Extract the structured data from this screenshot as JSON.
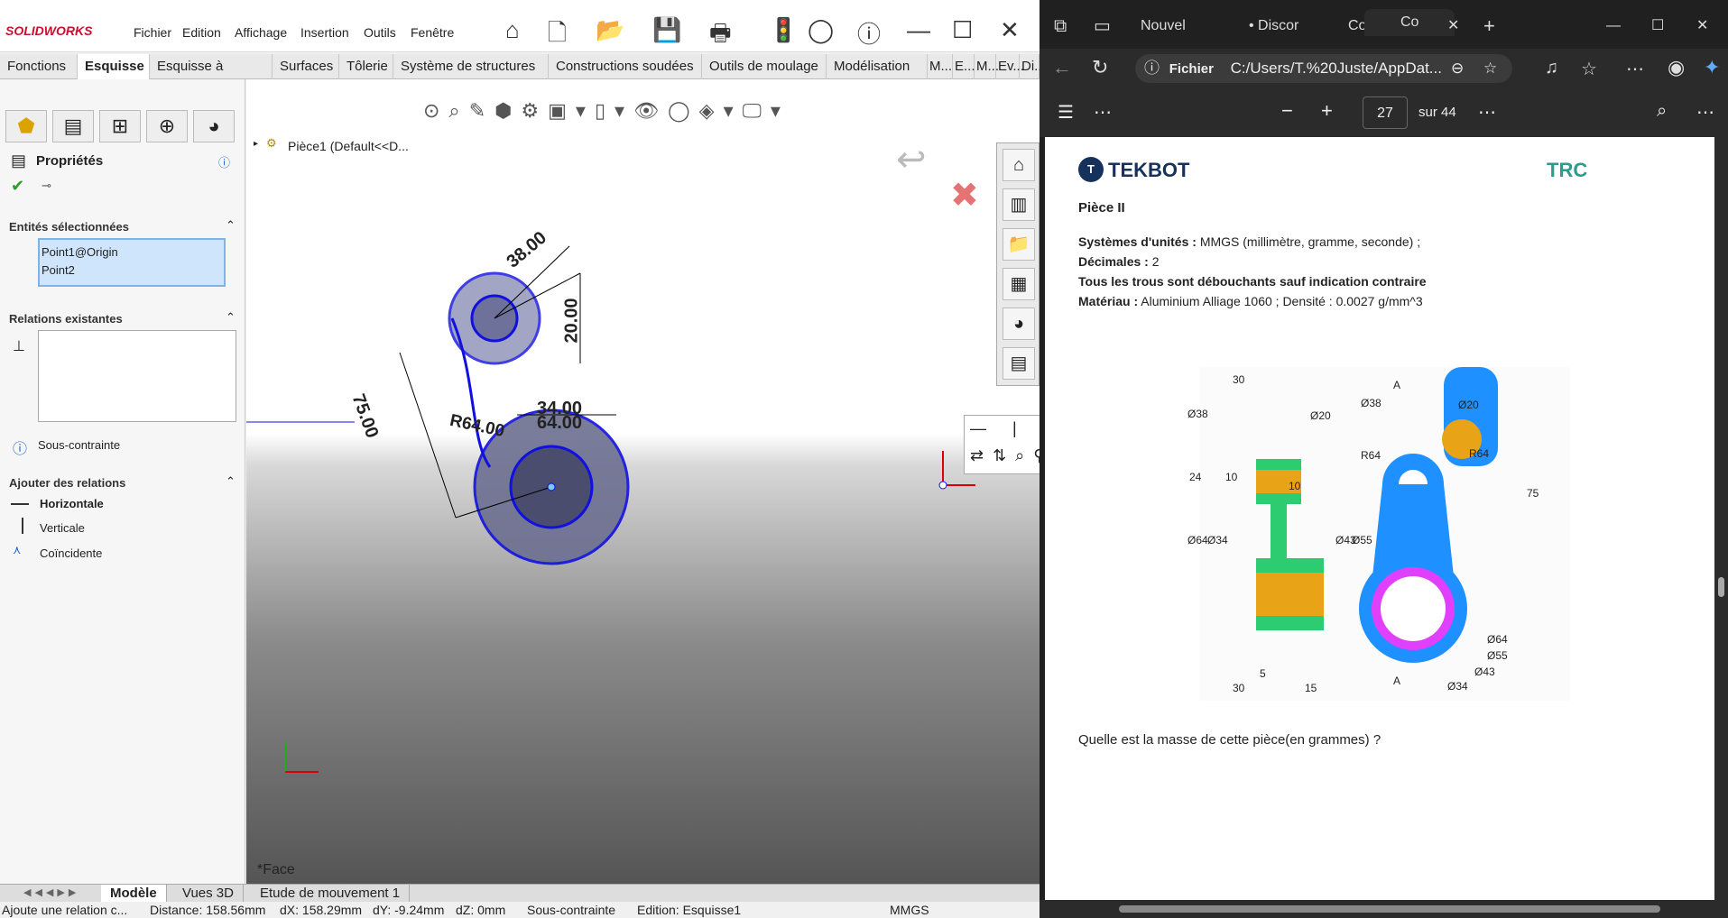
{
  "sw": {
    "logo": "SOLIDWORKS",
    "menus": [
      "Fichier",
      "Edition",
      "Affichage",
      "Insertion",
      "Outils",
      "Fenêtre"
    ],
    "tabs": [
      "Fonctions",
      "Esquisse",
      "Esquisse à l'encre",
      "Surfaces",
      "Tôlerie",
      "Système de structures",
      "Constructions soudées",
      "Outils de moulage",
      "Modélisation ...",
      "M...",
      "E...",
      "M...",
      "Ev...",
      "Di..."
    ],
    "active_tab": "Esquisse",
    "tree_item": "Pièce1  (Default<<D...",
    "props": {
      "title": "Propriétés",
      "sel_title": "Entités sélectionnées",
      "sel_items": [
        "Point1@Origin",
        "Point2"
      ],
      "rel_title": "Relations existantes",
      "status": "Sous-contrainte",
      "add_title": "Ajouter des relations",
      "relations": [
        "Horizontale",
        "Verticale",
        "Coïncidente"
      ]
    },
    "dims": {
      "d38": "38.00",
      "d20": "20.00",
      "r64": "R64.00",
      "l75": "75.00",
      "d34": "34.00",
      "d64": "64.00"
    },
    "face_label": "*Face",
    "bottom_tabs": [
      "Modèle",
      "Vues 3D",
      "Etude de mouvement 1"
    ],
    "status": {
      "msg": "Ajoute une relation c...",
      "distance": "Distance: 158.56mm",
      "dx": "dX: 158.29mm",
      "dy": "dY: -9.24mm",
      "dz": "dZ: 0mm",
      "constraint": "Sous-contrainte",
      "edition": "Edition: Esquisse1",
      "units": "MMGS"
    }
  },
  "edge": {
    "tabs": [
      "Nouvel",
      "• Discor",
      "Comme",
      "Co"
    ],
    "address_label": "Fichier",
    "address": "C:/Users/T.%20Juste/AppDat...",
    "page_current": "27",
    "page_total": "sur 44"
  },
  "pdf": {
    "brand_left": "TEKBOT",
    "brand_right": "TRC",
    "title": "Pièce II",
    "units_label": "Systèmes d'unités :",
    "units_value": " MMGS (millimètre, gramme, seconde) ;",
    "dec_label": "Décimales :",
    "dec_value": " 2",
    "holes": "Tous les trous sont débouchants sauf indication contraire",
    "mat_label": "Matériau :",
    "mat_value": " Aluminium Alliage 1060 ; Densité : 0.0027 g/mm^3",
    "question": "Quelle est la masse de cette pièce(en grammes) ?",
    "drawing": {
      "w30": "30",
      "d38": "Ø38",
      "d20": "Ø20",
      "v24": "24",
      "v10a": "10",
      "v10b": "10",
      "d64": "Ø64",
      "d34": "Ø34",
      "d43": "Ø43",
      "d55": "Ø55",
      "w5": "5",
      "w30b": "30",
      "w15": "15",
      "a": "A",
      "a2": "A",
      "r64a": "R64",
      "r64b": "R64",
      "v75": "75",
      "c64": "Ø64",
      "c55": "Ø55",
      "c43": "Ø43",
      "c34": "Ø34",
      "c38": "Ø38",
      "c20": "Ø20"
    }
  },
  "colors": {
    "sw_red": "#c8102e",
    "sketch_blue": "#1010e0",
    "hatch_green": "#2ecc71",
    "bore_orange": "#e8a317",
    "part_blue": "#1e90ff",
    "ring_magenta": "#e040fb"
  }
}
